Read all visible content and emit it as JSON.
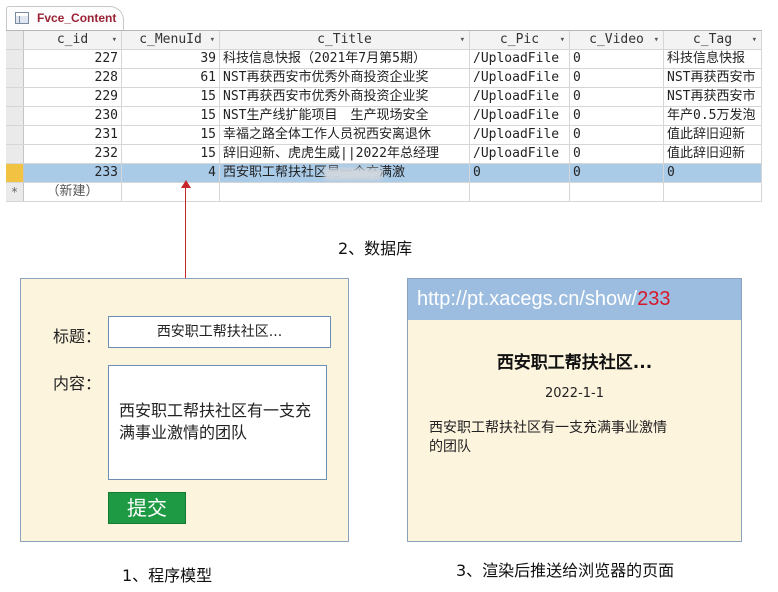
{
  "table": {
    "tab_title": "Fvce_Content",
    "columns": [
      {
        "label": "c_id",
        "dropdown": "▾"
      },
      {
        "label": "c_MenuId",
        "dropdown": "▾"
      },
      {
        "label": "c_Title",
        "dropdown": "▾"
      },
      {
        "label": "c_Pic",
        "dropdown": "▾"
      },
      {
        "label": "c_Video",
        "dropdown": "▾"
      },
      {
        "label": "c_Tag",
        "dropdown": "▾"
      }
    ],
    "rows": [
      {
        "id": "227",
        "menu": "39",
        "title": "科技信息快报（2021年7月第5期）",
        "pic": "/UploadFile",
        "video": "0",
        "tag": "科技信息快报"
      },
      {
        "id": "228",
        "menu": "61",
        "title": "NST再获西安市优秀外商投资企业奖",
        "pic": "/UploadFile",
        "video": "0",
        "tag": "NST再获西安市"
      },
      {
        "id": "229",
        "menu": "15",
        "title": "NST再获西安市优秀外商投资企业奖",
        "pic": "/UploadFile",
        "video": "0",
        "tag": "NST再获西安市"
      },
      {
        "id": "230",
        "menu": "15",
        "title": "NST生产线扩能项目　生产现场安全",
        "pic": "/UploadFile",
        "video": "0",
        "tag": "年产0.5万发泡"
      },
      {
        "id": "231",
        "menu": "15",
        "title": "幸福之路全体工作人员祝西安离退休",
        "pic": "/UploadFile",
        "video": "0",
        "tag": "值此辞旧迎新"
      },
      {
        "id": "232",
        "menu": "15",
        "title": "辞旧迎新、虎虎生威||2022年总经理",
        "pic": "/UploadFile",
        "video": "0",
        "tag": "值此辞旧迎新"
      },
      {
        "id": "233",
        "menu": "4",
        "title": "西安职工帮扶社区是一个充满激",
        "pic": "0",
        "video": "0",
        "tag": "0"
      }
    ],
    "new_row_marker": "*",
    "new_row_label": "（新建）"
  },
  "captions": {
    "database": "2、数据库",
    "program_model": "1、程序模型",
    "rendered_page": "3、渲染后推送给浏览器的页面"
  },
  "form": {
    "title_label": "标题：",
    "title_value": "西安职工帮扶社区...",
    "content_label": "内容：",
    "content_value": "西安职工帮扶社区有一支充满事业激情的团队",
    "submit_label": "提交"
  },
  "rendered": {
    "url_prefix": "http://pt.xacegs.cn/show/",
    "url_id": "233",
    "title": "西安职工帮扶社区...",
    "date": "2022-1-1",
    "body": "西安职工帮扶社区有一支充满事业激情的团队"
  },
  "colors": {
    "arrow": "#c4282a",
    "url_id": "#d8182b",
    "submit": "#1f9a44",
    "selected_row": "#a9cbe8",
    "panel_bg": "#fdf4de"
  }
}
